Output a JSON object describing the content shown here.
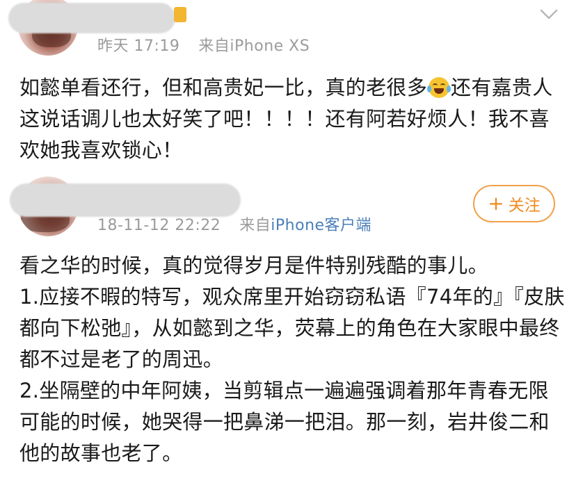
{
  "posts": [
    {
      "timestamp": "昨天 17:19",
      "source_prefix": "来自",
      "source": "iPhone XS",
      "content_lines": [
        "如懿单看还行，但和高贵妃一比，真的老很多",
        "还有嘉贵人这说话调儿也太好笑了吧！！！！还有阿若好烦人！我不喜欢她我喜欢锁心！"
      ],
      "emoji": "laugh-cry-emoji",
      "menu_icon": "chevron-down-icon"
    },
    {
      "timestamp": "18-11-12 22:22",
      "source_prefix": "来自",
      "source": "iPhone客户端",
      "follow_label": "关注",
      "follow_icon": "plus-icon",
      "paragraphs": [
        "看之华的时候，真的觉得岁月是件特别残酷的事儿。",
        "1.应接不暇的特写，观众席里开始窃窃私语『74年的』『皮肤都向下松弛』，从如懿到之华，荧幕上的角色在大家眼中最终都不过是老了的周迅。",
        "2.坐隔壁的中年阿姨，当剪辑点一遍遍强调着那年青春无限可能的时候，她哭得一把鼻涕一把泪。那一刻，岩井俊二和他的故事也老了。"
      ]
    }
  ],
  "colors": {
    "accent_orange": "#f08a1e",
    "meta_gray": "#9b9b9b",
    "link_blue": "#4a7fb8",
    "text": "#1a1a1a"
  }
}
